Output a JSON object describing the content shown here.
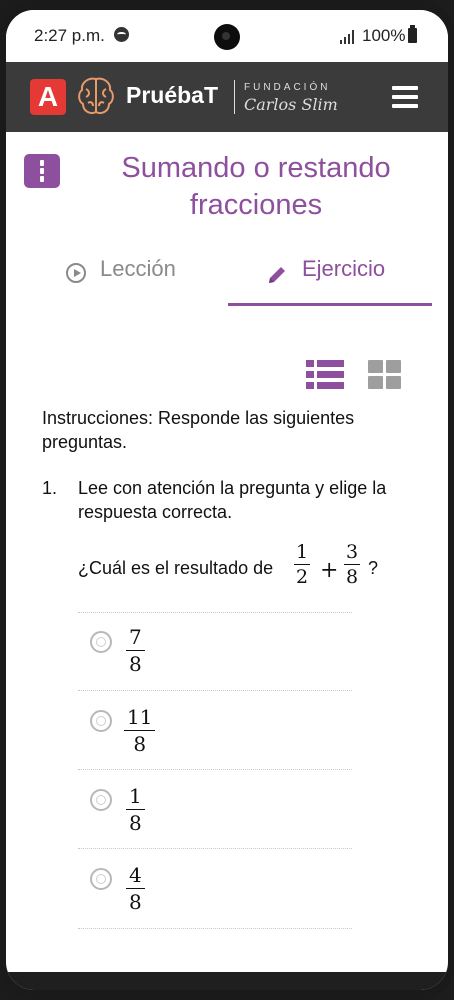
{
  "status_bar": {
    "time": "2:27 p.m.",
    "battery": "100%",
    "icons": [
      "spotify-icon",
      "camera-cutout",
      "signal-icon",
      "battery-icon"
    ]
  },
  "app_bar": {
    "logo_letter": "A",
    "brand": "PruébaT",
    "foundation_line1": "FUNDACIÓN",
    "foundation_line2": "Carlos Slim",
    "colors": {
      "background": "#3b3b3b",
      "logo": "#e53935"
    }
  },
  "page": {
    "title": "Sumando o restando fracciones",
    "accent_color": "#8e4f9e"
  },
  "tabs": [
    {
      "label": "Lección",
      "active": false,
      "icon": "play-circle-icon"
    },
    {
      "label": "Ejercicio",
      "active": true,
      "icon": "pencil-icon"
    }
  ],
  "view_toggle": {
    "list": "list-view-icon",
    "grid": "grid-view-icon",
    "selected": "list"
  },
  "instructions": "Instrucciones: Responde las siguientes preguntas.",
  "question": {
    "number": "1.",
    "prompt": "Lee con atención la pregunta y elige la respuesta correcta.",
    "text": "¿Cuál es el resultado de",
    "operand1": {
      "num": "1",
      "den": "2"
    },
    "operator": "+",
    "operand2": {
      "num": "3",
      "den": "8"
    },
    "end": "?"
  },
  "options": [
    {
      "num": "7",
      "den": "8"
    },
    {
      "num": "11",
      "den": "8"
    },
    {
      "num": "1",
      "den": "8"
    },
    {
      "num": "4",
      "den": "8"
    }
  ]
}
